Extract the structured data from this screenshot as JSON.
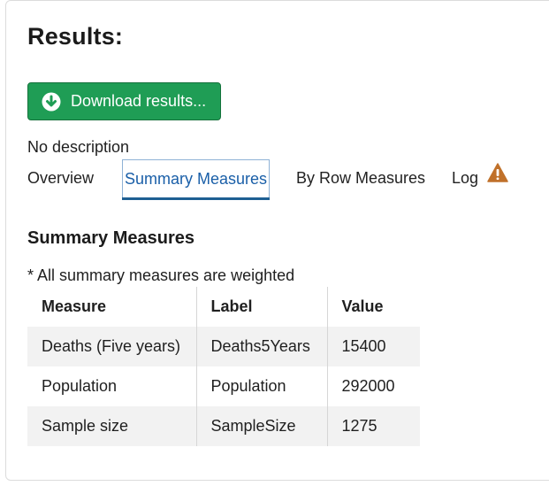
{
  "header": {
    "title": "Results:"
  },
  "download": {
    "label": "Download results...",
    "icon": "download-circle-icon",
    "color": "#1f9d55"
  },
  "description": "No description",
  "tabs": [
    {
      "label": "Overview",
      "active": false
    },
    {
      "label": "Summary Measures",
      "active": true
    },
    {
      "label": "By Row Measures",
      "active": false
    },
    {
      "label": "Log",
      "active": false,
      "icon": "warning-icon",
      "icon_color": "#c0712a"
    }
  ],
  "summary": {
    "title": "Summary Measures",
    "note": "* All summary measures are weighted",
    "columns": [
      "Measure",
      "Label",
      "Value"
    ],
    "rows": [
      [
        "Deaths (Five years)",
        "Deaths5Years",
        "15400"
      ],
      [
        "Population",
        "Population",
        "292000"
      ],
      [
        "Sample size",
        "SampleSize",
        "1275"
      ]
    ]
  }
}
